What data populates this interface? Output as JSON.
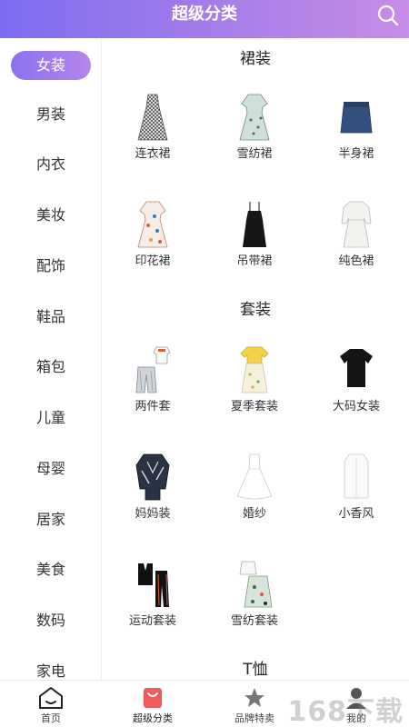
{
  "header": {
    "title": "超级分类",
    "search_icon": "search-icon",
    "gradient": [
      "#7d6cf2",
      "#c78de8"
    ]
  },
  "sidebar": {
    "active_index": 0,
    "items": [
      {
        "label": "女装"
      },
      {
        "label": "男装"
      },
      {
        "label": "内衣"
      },
      {
        "label": "美妆"
      },
      {
        "label": "配饰"
      },
      {
        "label": "鞋品"
      },
      {
        "label": "箱包"
      },
      {
        "label": "儿童"
      },
      {
        "label": "母婴"
      },
      {
        "label": "居家"
      },
      {
        "label": "美食"
      },
      {
        "label": "数码"
      },
      {
        "label": "家电"
      }
    ]
  },
  "sections": [
    {
      "title": "裙装",
      "items": [
        {
          "label": "连衣裙",
          "icon": "gingham-dress-icon"
        },
        {
          "label": "雪纺裙",
          "icon": "floral-dress-icon"
        },
        {
          "label": "半身裙",
          "icon": "denim-skirt-icon"
        },
        {
          "label": "印花裙",
          "icon": "print-dress-icon"
        },
        {
          "label": "吊带裙",
          "icon": "slip-dress-icon"
        },
        {
          "label": "纯色裙",
          "icon": "white-dress-icon"
        }
      ]
    },
    {
      "title": "套装",
      "items": [
        {
          "label": "两件套",
          "icon": "two-piece-set-icon"
        },
        {
          "label": "夏季套装",
          "icon": "summer-set-icon"
        },
        {
          "label": "大码女装",
          "icon": "black-tshirt-icon"
        },
        {
          "label": "妈妈装",
          "icon": "mom-outfit-icon"
        },
        {
          "label": "婚纱",
          "icon": "wedding-dress-icon"
        },
        {
          "label": "小香风",
          "icon": "white-coat-icon"
        },
        {
          "label": "运动套装",
          "icon": "sport-set-icon"
        },
        {
          "label": "雪纺套装",
          "icon": "chiffon-set-icon"
        }
      ]
    },
    {
      "title": "T恤",
      "items": []
    }
  ],
  "tabbar": {
    "active_index": 1,
    "items": [
      {
        "label": "首页",
        "icon": "home-icon"
      },
      {
        "label": "超级分类",
        "icon": "shopping-bag-icon"
      },
      {
        "label": "品牌特卖",
        "icon": "star-icon"
      },
      {
        "label": "我的",
        "icon": "user-icon"
      }
    ]
  },
  "watermark": "168下载",
  "colors": {
    "accent": "#8b72f0",
    "accent_light": "#b784ec",
    "tab_active": "#f05a5a"
  }
}
